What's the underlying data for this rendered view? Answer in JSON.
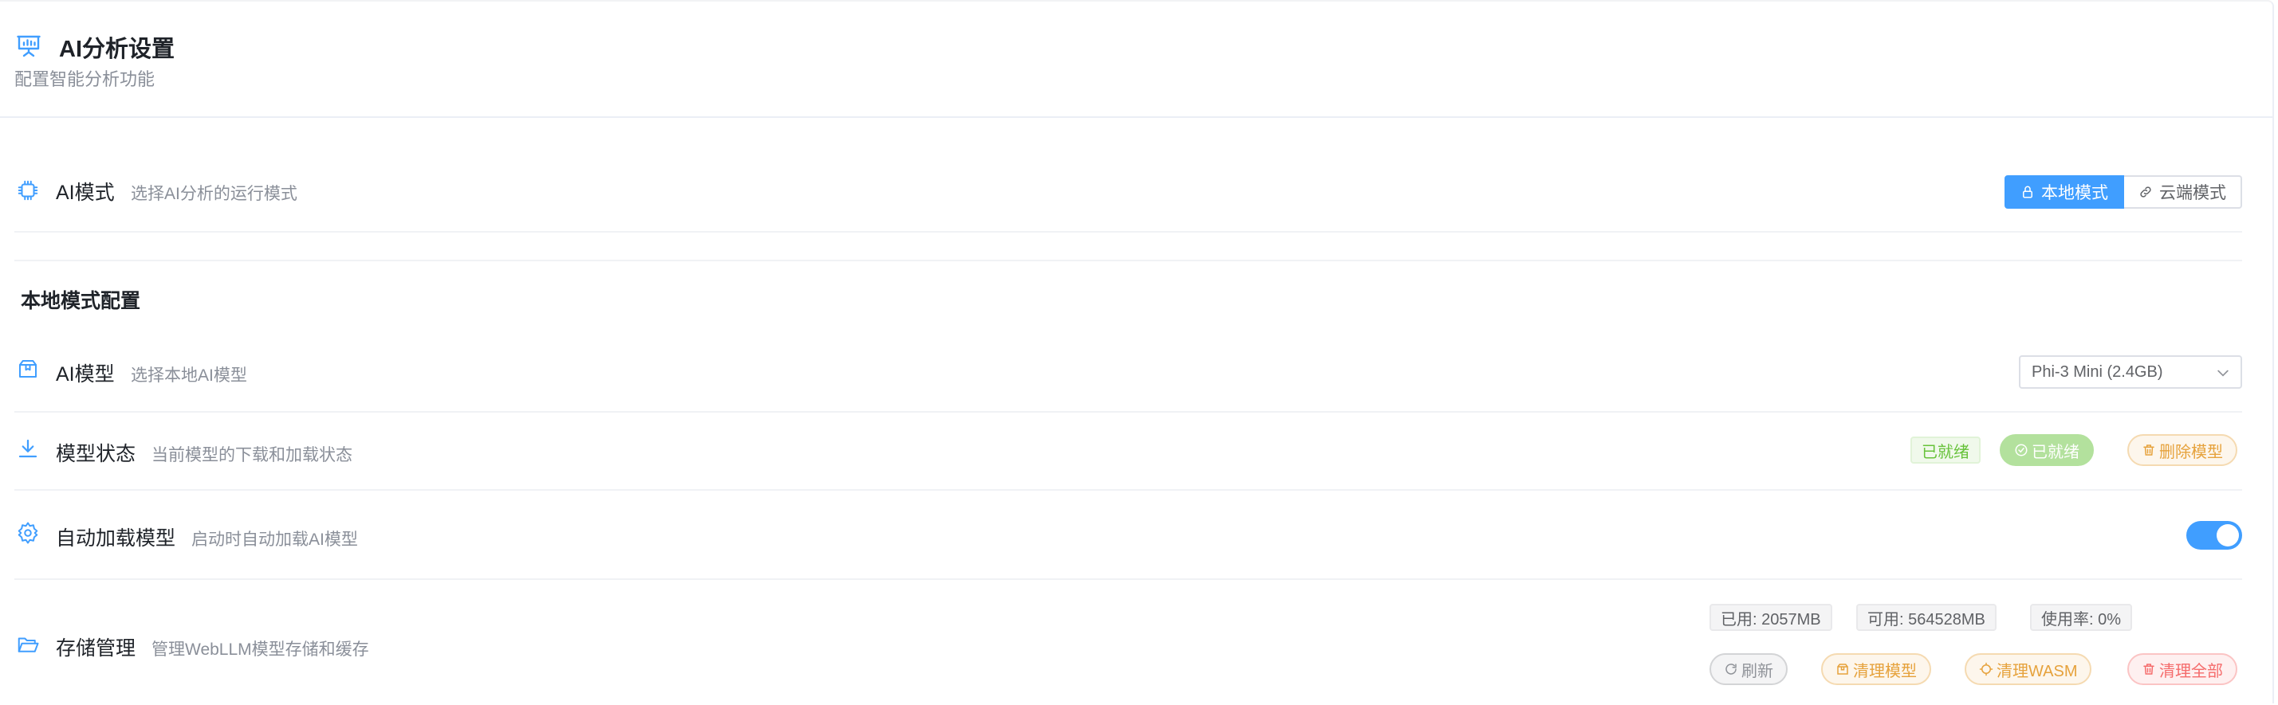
{
  "header": {
    "title": "AI分析设置",
    "subtitle": "配置智能分析功能",
    "icon": "presentation-chart-icon"
  },
  "ai_mode": {
    "title": "AI模式",
    "desc": "选择AI分析的运行模式",
    "icon": "cpu-chip-icon",
    "options": [
      {
        "label": "本地模式",
        "icon": "lock-icon",
        "active": true
      },
      {
        "label": "云端模式",
        "icon": "link-icon",
        "active": false
      }
    ]
  },
  "local_section": {
    "title": "本地模式配置"
  },
  "ai_model": {
    "title": "AI模型",
    "desc": "选择本地AI模型",
    "icon": "box-icon",
    "selected": "Phi-3 Mini (2.4GB)"
  },
  "model_status": {
    "title": "模型状态",
    "desc": "当前模型的下载和加载状态",
    "icon": "download-icon",
    "status_tag": "已就绪",
    "ready_button": "已就绪",
    "delete_button": "删除模型"
  },
  "auto_load": {
    "title": "自动加载模型",
    "desc": "启动时自动加载AI模型",
    "icon": "gear-icon",
    "enabled": true
  },
  "storage": {
    "title": "存储管理",
    "desc": "管理WebLLM模型存储和缓存",
    "icon": "folder-open-icon",
    "used": "已用: 2057MB",
    "available": "可用: 564528MB",
    "usage": "使用率: 0%",
    "buttons": {
      "refresh": "刷新",
      "clear_models": "清理模型",
      "clear_wasm": "清理WASM",
      "clear_all": "清理全部"
    }
  },
  "colors": {
    "primary": "#409eff",
    "success": "#67c23a",
    "warning": "#e6a23c",
    "danger": "#f56c6c"
  }
}
